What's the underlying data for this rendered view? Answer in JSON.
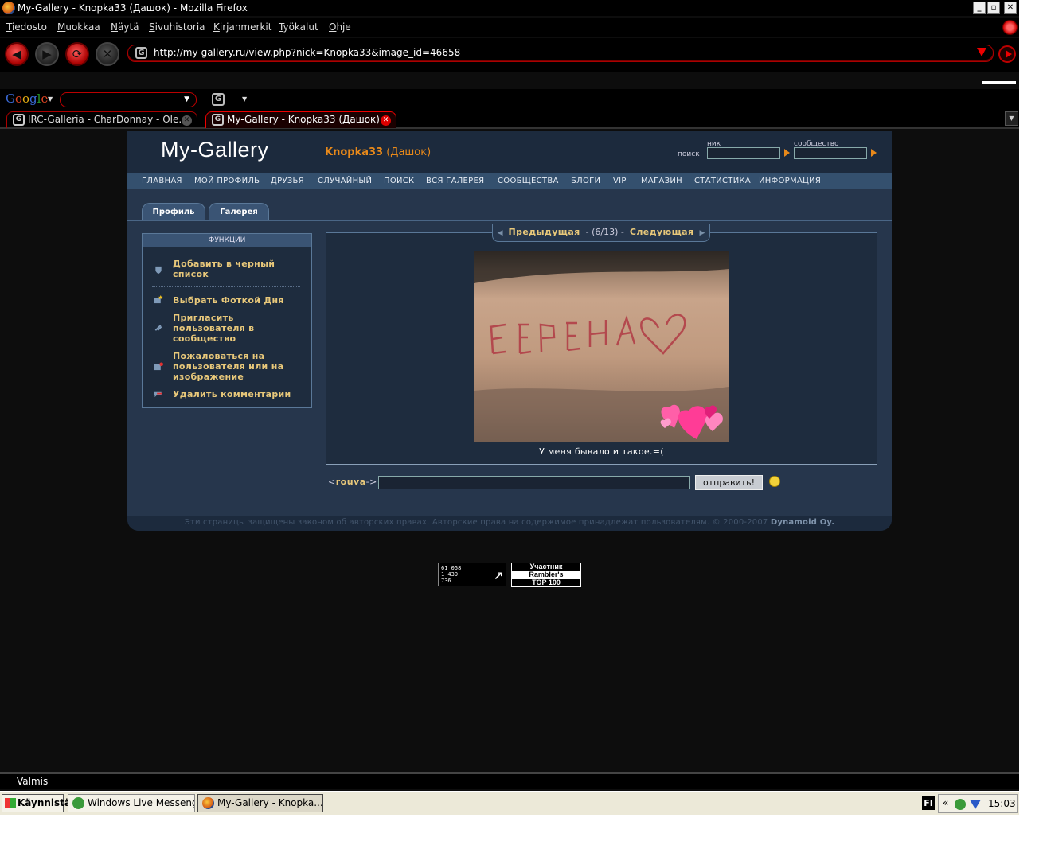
{
  "window": {
    "title": "My-Gallery - Knopka33 (Дашок) - Mozilla Firefox",
    "controls": [
      "_",
      "▫",
      "✕"
    ]
  },
  "menu": [
    "Tiedosto",
    "Muokkaa",
    "Näytä",
    "Sivuhistoria",
    "Kirjanmerkit",
    "Työkalut",
    "Ohje"
  ],
  "nav": {
    "url": "http://my-gallery.ru/view.php?nick=Knopka33&image_id=46658"
  },
  "google": {
    "logo": [
      "G",
      "o",
      "o",
      "g",
      "l",
      "e"
    ]
  },
  "tabs": [
    {
      "label": "IRC-Galleria - CharDonnay - Ole..."
    },
    {
      "label": "My-Gallery - Knopka33 (Дашок)"
    }
  ],
  "site": {
    "logo": "My-Gallery",
    "user_nick": "Knopka33",
    "user_name": "(Дашок)",
    "search_label": "поиск",
    "nick_label": "ник",
    "community_label": "сообщество",
    "nav": [
      "ГЛАВНАЯ",
      "МОЙ ПРОФИЛЬ",
      "ДРУЗЬЯ",
      "СЛУЧАЙНЫЙ",
      "ПОИСК",
      "ВСЯ ГАЛЕРЕЯ",
      "СООБЩЕСТВА",
      "БЛОГИ",
      "VIP",
      "МАГАЗИН",
      "СТАТИСТИКА",
      "ИНФОРМАЦИЯ"
    ],
    "profile_tabs": [
      "Профиль",
      "Галерея"
    ],
    "functions": {
      "title": "ФУНКЦИИ",
      "items": [
        "Добавить в черный список",
        "Выбрать Фоткой Дня",
        "Пригласить пользователя в сообщество",
        "Пожаловаться на пользователя или на изображение",
        "Удалить комментарии"
      ]
    },
    "pager": {
      "prev": "Предыдущая",
      "count": "- (6/13) -",
      "next": "Следующая"
    },
    "photo": {
      "caption": "У меня бывало и такое.=("
    },
    "comment": {
      "nick_open": "<",
      "nick": "rouva",
      "nick_close": "->",
      "send": "отправить!"
    },
    "footer": {
      "text": "Эти страницы защищены законом об авторских правах. Авторские права на содержимое принадлежат пользователям. © 2000-2007",
      "owner": "Dynamoid Oy."
    }
  },
  "counters": {
    "c1": [
      "61 058",
      "1 439",
      "736"
    ],
    "c2": [
      "Участник",
      "Rambler's",
      "TOP 100"
    ]
  },
  "status": "Valmis",
  "taskbar": {
    "start": "Käynnistä",
    "tasks": [
      "Windows Live Messenger",
      "My-Gallery - Knopka..."
    ],
    "tray_fi": "FI",
    "chevron": "«",
    "clock": "15:03"
  }
}
